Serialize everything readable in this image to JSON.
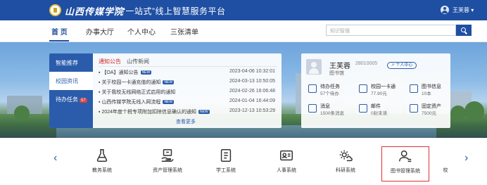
{
  "header": {
    "school_name": "山西传媒学院",
    "platform_title": "“一站式”线上智慧服务平台",
    "user_name": "王芙蓉"
  },
  "nav": {
    "items": [
      "首 页",
      "办事大厅",
      "个人中心",
      "三张清单"
    ],
    "active_index": 0
  },
  "search": {
    "placeholder": "知识智搜"
  },
  "left_card": {
    "vertical_tabs": [
      {
        "label": "智能推荐"
      },
      {
        "label": "校园资讯"
      },
      {
        "label": "待办任务",
        "badge": "57"
      }
    ],
    "sub_tabs": [
      "通知公告",
      "山传新闻"
    ],
    "notices": [
      {
        "title": "【OA】通知公告",
        "new": "NEW",
        "date": "2023-04-06 10:32:01"
      },
      {
        "title": "关于校园一卡通充值的通知",
        "new": "NEW",
        "date": "2024-03-13 10:50:05"
      },
      {
        "title": "关于我校无线网络正式启用的通知",
        "new": "",
        "date": "2024-02-26 16:06:48"
      },
      {
        "title": "山西传媒学院无线入网流程",
        "new": "NEW",
        "date": "2024-01-04 16:44:09"
      },
      {
        "title": "2024年度个税专项附加扣除信息确认的通知",
        "new": "NEW",
        "date": "2023-12-13 10:53:29"
      }
    ],
    "view_more": "查看更多"
  },
  "right_card": {
    "name": "王芙蓉",
    "id": "28010005",
    "dept": "图书馆",
    "button": "个人中心",
    "stats": [
      {
        "label": "待办任务",
        "value": "57个待办",
        "icon": "clipboard-icon"
      },
      {
        "label": "校园一卡通",
        "value": "77.90元",
        "icon": "card-icon"
      },
      {
        "label": "图书信息",
        "value": "10本",
        "icon": "book-icon"
      },
      {
        "label": "消息",
        "value": "1500条消息",
        "icon": "message-icon"
      },
      {
        "label": "邮件",
        "value": "0封未读",
        "icon": "mail-icon"
      },
      {
        "label": "固定资产",
        "value": "7500元",
        "icon": "asset-icon"
      }
    ]
  },
  "systems": [
    {
      "label": "教务系统",
      "icon": "flask-icon"
    },
    {
      "label": "资产管理系统",
      "icon": "asset-hand-icon"
    },
    {
      "label": "学工系统",
      "icon": "document-icon"
    },
    {
      "label": "人事系统",
      "icon": "id-card-icon"
    },
    {
      "label": "科研系统",
      "icon": "gear-cloud-icon"
    },
    {
      "label": "图书管理系统",
      "icon": "user-list-icon",
      "highlighted": true
    },
    {
      "label": "校",
      "icon": "partial"
    }
  ],
  "colors": {
    "brand_blue": "#1f4fa3",
    "highlight_red": "#e03030",
    "notice_red": "#d12a2a"
  }
}
